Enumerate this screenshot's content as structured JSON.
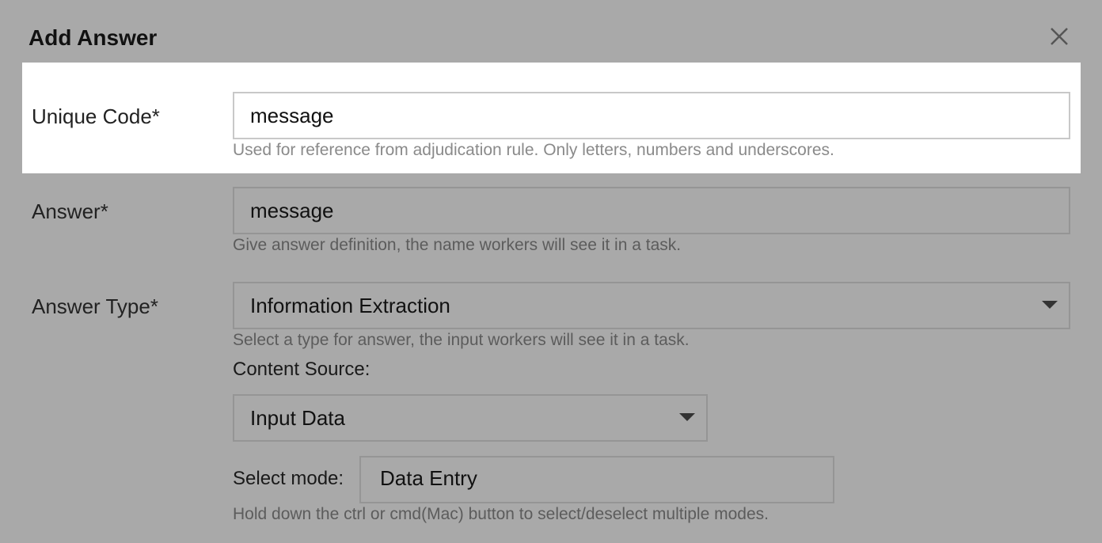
{
  "dialog": {
    "title": "Add Answer",
    "close_icon": "close-icon"
  },
  "unique_code": {
    "label": "Unique Code*",
    "value": "message",
    "hint": "Used for reference from adjudication rule. Only letters, numbers and underscores."
  },
  "answer": {
    "label": "Answer*",
    "value": "message",
    "hint": "Give answer definition, the name workers will see it in a task."
  },
  "answer_type": {
    "label": "Answer Type*",
    "selected": "Information Extraction",
    "hint": "Select a type for answer, the input workers will see it in a task."
  },
  "content_source": {
    "label": "Content Source:",
    "selected": "Input Data"
  },
  "select_mode": {
    "label": "Select mode:",
    "options": [
      "Data Entry"
    ],
    "hint": "Hold down the ctrl or cmd(Mac) button to select/deselect multiple modes."
  },
  "colors": {
    "overlay": "#a9a9a9",
    "highlight": "#ffffff"
  }
}
